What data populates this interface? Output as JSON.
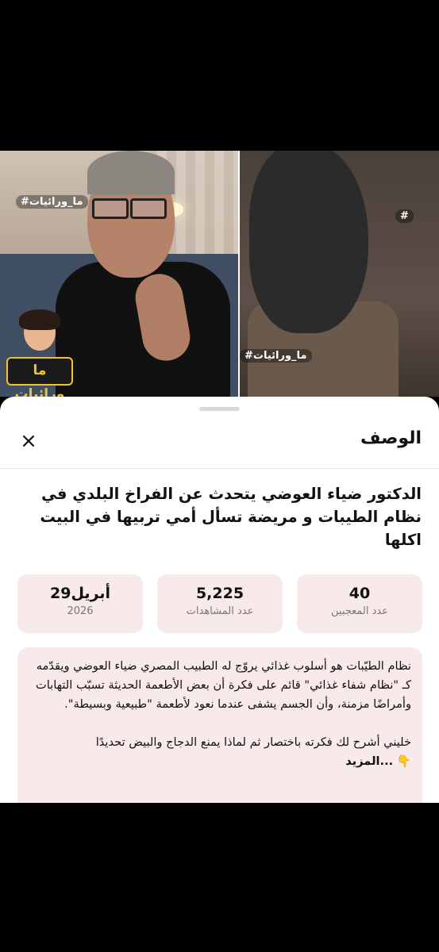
{
  "video": {
    "hashtag_left": "#ما_ورائيات",
    "hashtag_right_top": "#",
    "hashtag_right_bottom": "#ما_ورائيات",
    "avatar_badge": "ما ورائيات"
  },
  "sheet": {
    "title": "الوصف",
    "close_icon": "×",
    "headline": "الدكتور ضياء العوضي يتحدث عن الفراخ البلدي في نظام الطيبات و مريضة تسأل أمي تربيها في البيت اكلها",
    "stats": [
      {
        "value": "40",
        "label": "عدد المعجبين"
      },
      {
        "value": "5,225",
        "label": "عدد المشاهدات"
      },
      {
        "value": "أبريل29",
        "label": "2026"
      }
    ],
    "description": {
      "para1": "نظام الطيّبات هو أسلوب غذائي يروّج له الطبيب المصري ضياء العوضي ويقدّمه كـ \"نظام شفاء غذائي\" قائم على فكرة أن بعض الأطعمة الحديثة تسبّب التهابات وأمراضًا مزمنة، وأن الجسم يشفى عندما نعود لأطعمة \"طبيعية وبسيطة\".",
      "para2": "خليني أشرح لك فكرته باختصار ثم لماذا يمنع الدجاج والبيض تحديدًا",
      "pointer_icon": "👇",
      "more_label": "...المزيد"
    }
  }
}
